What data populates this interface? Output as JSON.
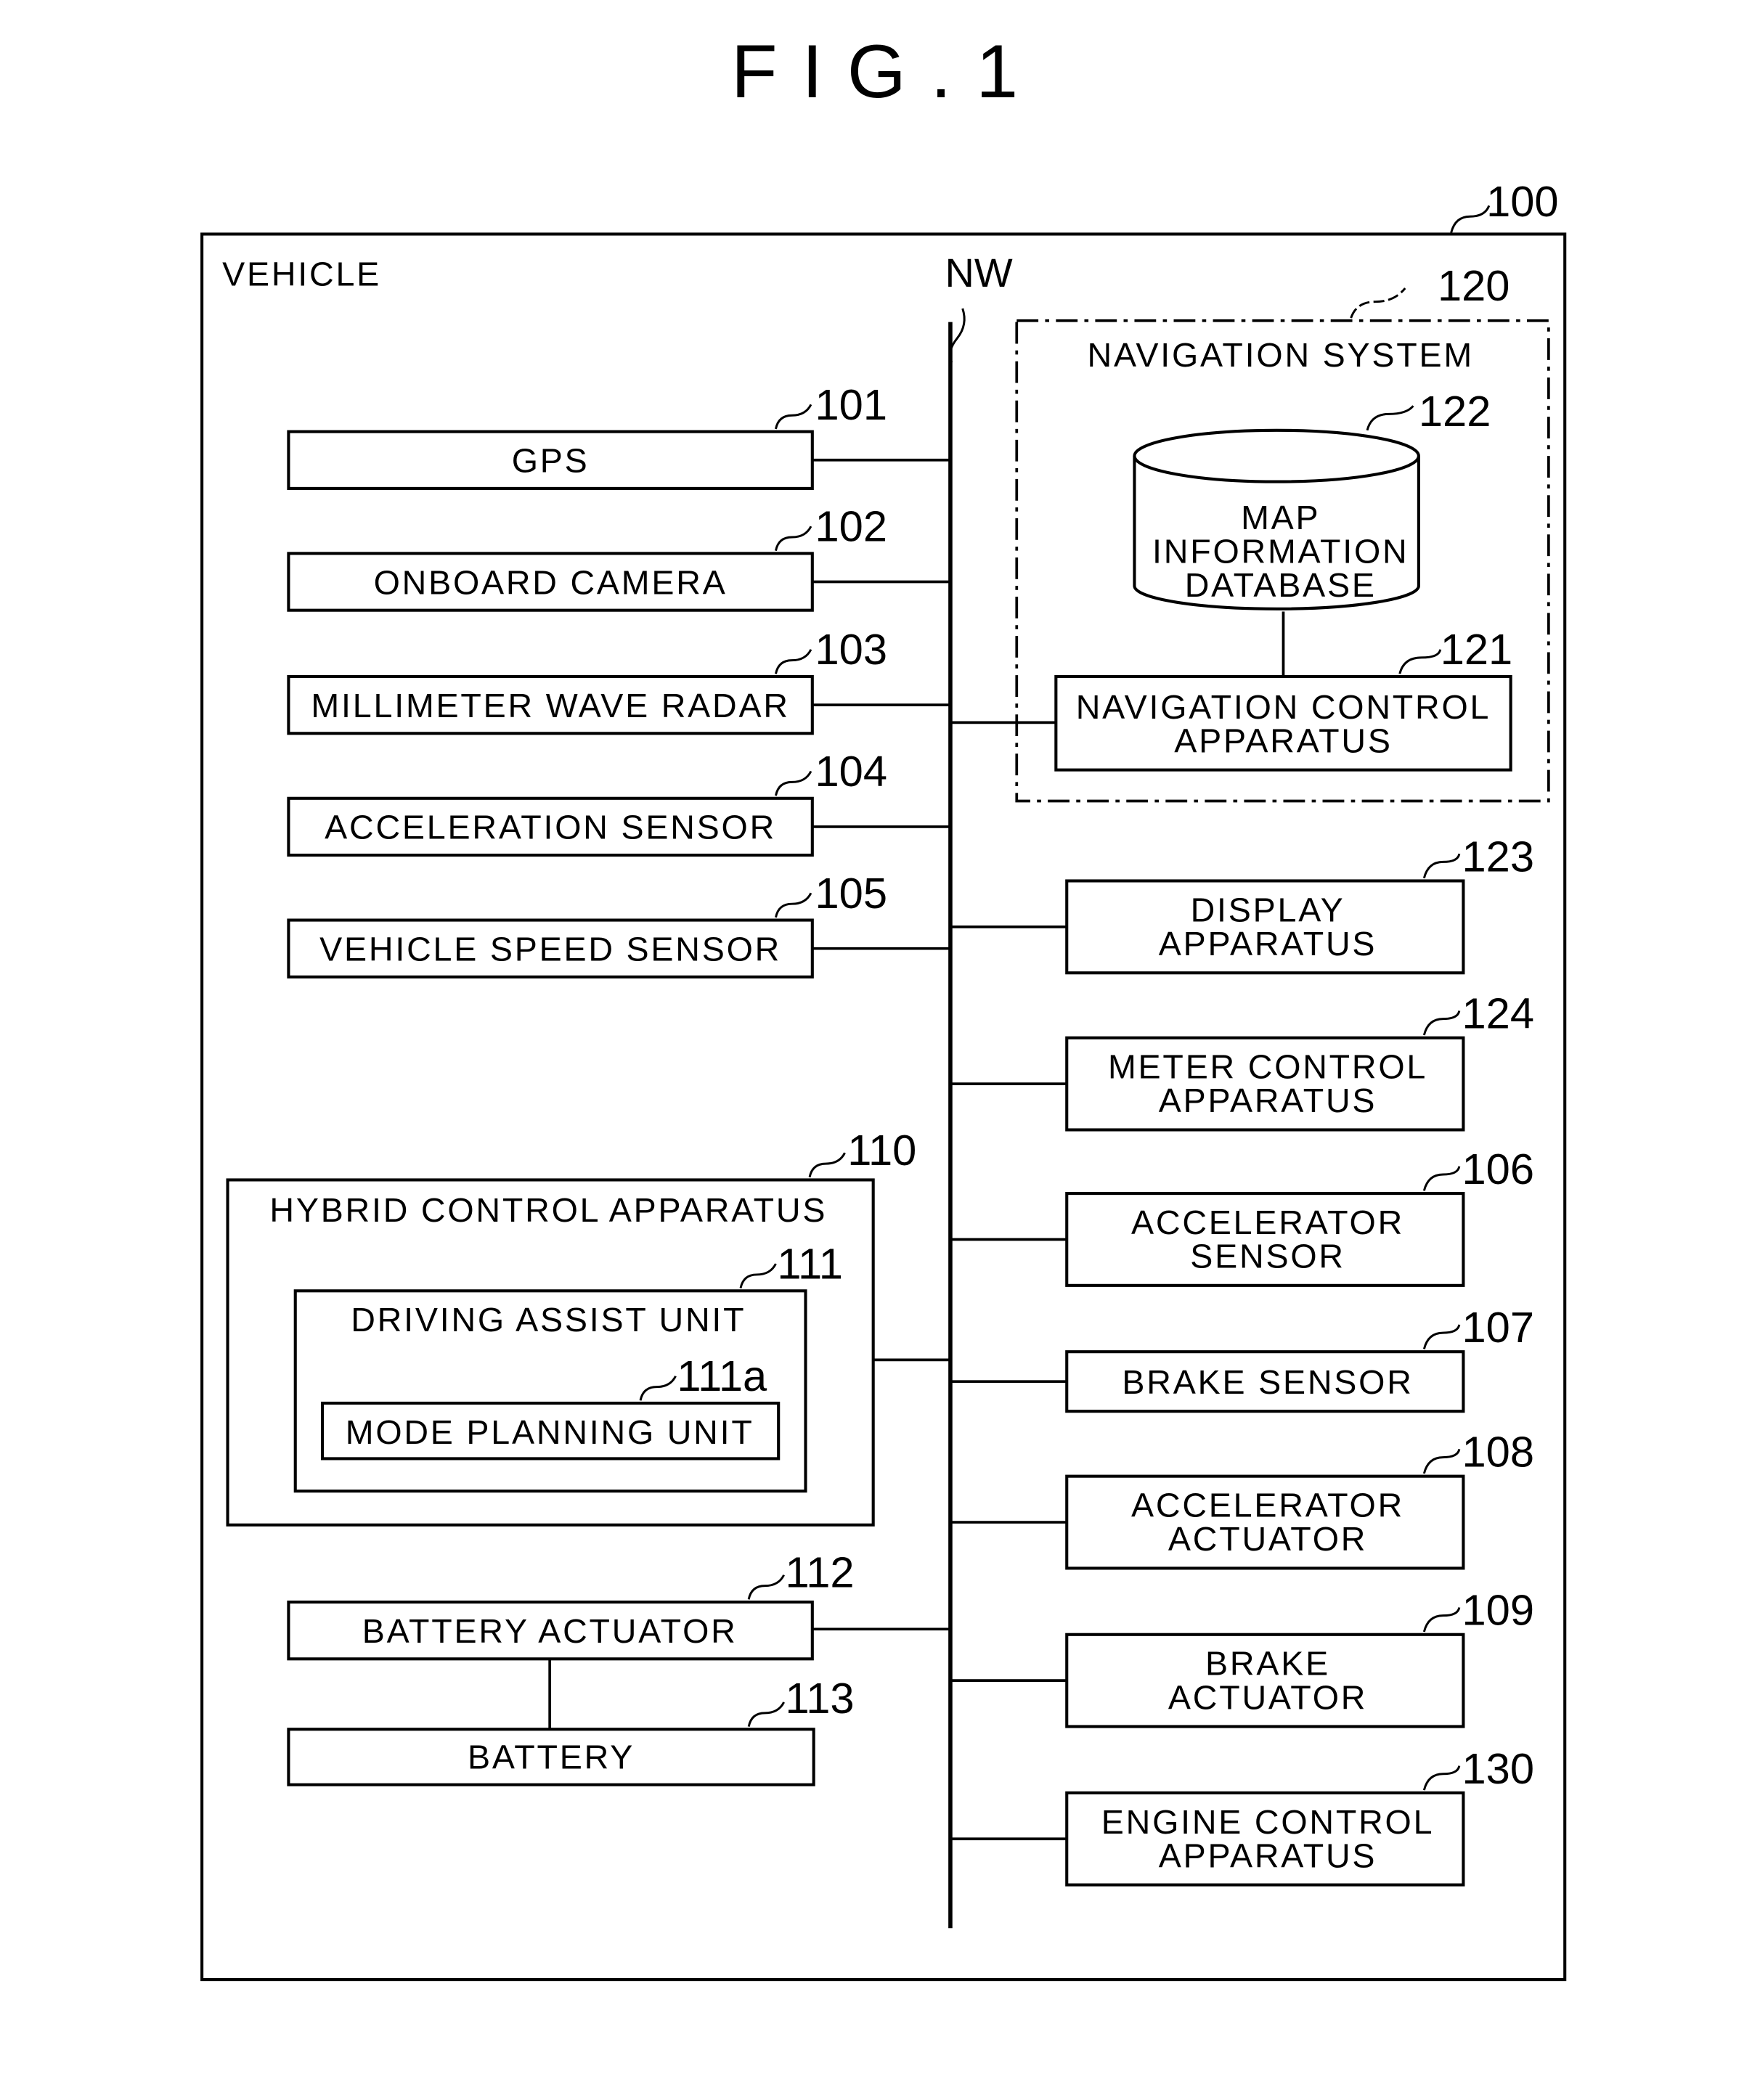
{
  "figure_title": "FIG.1",
  "vehicle": {
    "label": "VEHICLE",
    "ref": "100"
  },
  "network": {
    "label": "NW"
  },
  "left_components": [
    {
      "label": "GPS",
      "ref": "101"
    },
    {
      "label": "ONBOARD CAMERA",
      "ref": "102"
    },
    {
      "label": "MILLIMETER WAVE RADAR",
      "ref": "103"
    },
    {
      "label": "ACCELERATION SENSOR",
      "ref": "104"
    },
    {
      "label": "VEHICLE SPEED SENSOR",
      "ref": "105"
    }
  ],
  "hybrid_control": {
    "label": "HYBRID CONTROL APPARATUS",
    "ref": "110",
    "driving_assist": {
      "label": "DRIVING ASSIST UNIT",
      "ref": "111"
    },
    "mode_planning": {
      "label": "MODE PLANNING UNIT",
      "ref": "111a"
    }
  },
  "battery_actuator": {
    "label": "BATTERY ACTUATOR",
    "ref": "112"
  },
  "battery": {
    "label": "BATTERY",
    "ref": "113"
  },
  "navigation_system": {
    "label": "NAVIGATION SYSTEM",
    "ref": "120",
    "database": {
      "lines": [
        "MAP",
        "INFORMATION",
        "DATABASE"
      ],
      "ref": "122"
    },
    "control": {
      "lines": [
        "NAVIGATION CONTROL",
        "APPARATUS"
      ],
      "ref": "121"
    }
  },
  "right_components": [
    {
      "lines": [
        "DISPLAY",
        "APPARATUS"
      ],
      "ref": "123"
    },
    {
      "lines": [
        "METER CONTROL",
        "APPARATUS"
      ],
      "ref": "124"
    },
    {
      "lines": [
        "ACCELERATOR",
        "SENSOR"
      ],
      "ref": "106"
    },
    {
      "lines": [
        "BRAKE SENSOR"
      ],
      "ref": "107"
    },
    {
      "lines": [
        "ACCELERATOR",
        "ACTUATOR"
      ],
      "ref": "108"
    },
    {
      "lines": [
        "BRAKE",
        "ACTUATOR"
      ],
      "ref": "109"
    },
    {
      "lines": [
        "ENGINE CONTROL",
        "APPARATUS"
      ],
      "ref": "130"
    }
  ]
}
